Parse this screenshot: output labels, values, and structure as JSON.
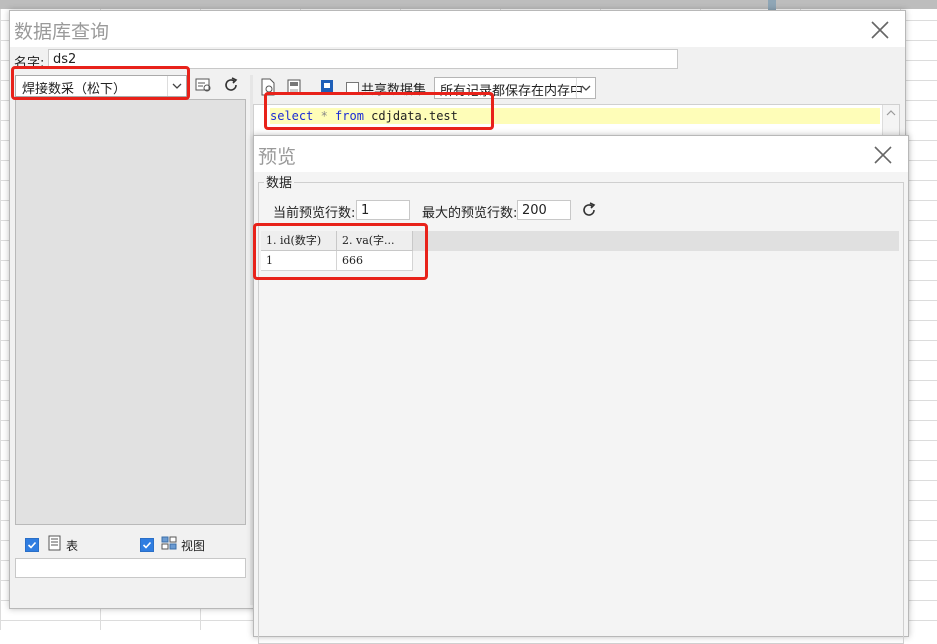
{
  "main_dialog": {
    "title": "数据库查询",
    "name_label": "名字:",
    "name_value": "ds2",
    "datasource_value": "焊接数采（松下）",
    "show_table_label": "表",
    "show_view_label": "视图",
    "share_dataset_label": "共享数据集",
    "memory_mode_value": "所有记录都保存在内存中",
    "sql": {
      "kw1": "select",
      "op": " * ",
      "kw2": "from",
      "table": " cdjdata.test"
    }
  },
  "preview_dialog": {
    "title": "预览",
    "group_label": "数据",
    "current_rows_label": "当前预览行数:",
    "current_rows_value": "1",
    "max_rows_label": "最大的预览行数:",
    "max_rows_value": "200",
    "columns": [
      "1. id(数字)",
      "2. va(字..."
    ],
    "rows": [
      [
        "1",
        "666"
      ]
    ]
  },
  "icons": {
    "close": "close-icon",
    "refresh": "refresh-icon",
    "table": "table-icon",
    "view": "view-icon"
  },
  "colors": {
    "highlight": "#e8221a",
    "checkbox": "#2f7de1",
    "sql_keyword": "#1b2bd6",
    "sql_line_bg": "#fefdb8"
  }
}
